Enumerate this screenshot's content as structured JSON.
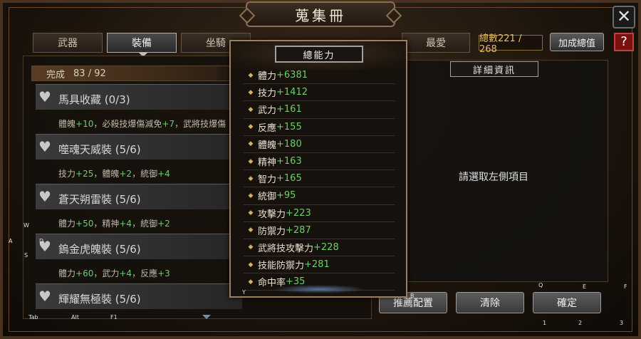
{
  "window": {
    "title": "蒐集冊"
  },
  "tabs": [
    {
      "label": "武器"
    },
    {
      "label": "裝備"
    },
    {
      "label": "坐騎"
    },
    {
      "label": "最愛"
    }
  ],
  "total": {
    "text": "總數221 / 268"
  },
  "bonus_button": "加成總值",
  "help_button": "?",
  "close_button": "✕",
  "progress": {
    "label": "完成",
    "value": "83 / 92",
    "fraction": 0.902
  },
  "sets": [
    {
      "name": "馬具收藏 (0/3)",
      "parts": [
        [
          "體魄",
          "+10"
        ],
        [
          "，必殺技爆傷減免",
          "+7"
        ],
        [
          "，武將技爆傷",
          ""
        ]
      ]
    },
    {
      "name": "噬魂天威裝 (5/6)",
      "parts": [
        [
          "技力",
          "+25"
        ],
        [
          "，體魄",
          "+2"
        ],
        [
          "，統御",
          "+4"
        ]
      ]
    },
    {
      "name": "蒼天朔雷裝 (5/6)",
      "parts": [
        [
          "體力",
          "+50"
        ],
        [
          "，精神",
          "+4"
        ],
        [
          "，統御",
          "+2"
        ]
      ]
    },
    {
      "name": "鎢金虎魄裝 (5/6)",
      "parts": [
        [
          "體力",
          "+60"
        ],
        [
          "，武力",
          "+4"
        ],
        [
          "，反應",
          "+3"
        ]
      ]
    },
    {
      "name": "輝耀無極裝 (5/6)",
      "parts": []
    }
  ],
  "popup": {
    "title": "總能力",
    "stats": [
      {
        "name": "體力",
        "value": "+6381"
      },
      {
        "name": "技力",
        "value": "+1412"
      },
      {
        "name": "武力",
        "value": "+161"
      },
      {
        "name": "反應",
        "value": "+155"
      },
      {
        "name": "體魄",
        "value": "+180"
      },
      {
        "name": "精神",
        "value": "+163"
      },
      {
        "name": "智力",
        "value": "+165"
      },
      {
        "name": "統御",
        "value": "+95"
      },
      {
        "name": "攻擊力",
        "value": "+223"
      },
      {
        "name": "防禦力",
        "value": "+287"
      },
      {
        "name": "武將技攻擊力",
        "value": "+228"
      },
      {
        "name": "技能防禦力",
        "value": "+281"
      },
      {
        "name": "命中率",
        "value": "+35"
      }
    ]
  },
  "detail": {
    "title": "詳細資訊",
    "empty_text": "請選取左側項目"
  },
  "buttons": {
    "recommend": "推薦配置",
    "clear": "清除",
    "confirm": "確定"
  },
  "hotkeys": [
    "W",
    "A",
    "S",
    "D",
    "Tab",
    "Alt",
    "F1",
    "Y",
    "B",
    "Q",
    "E",
    "F",
    "1",
    "2",
    "3"
  ],
  "colors": {
    "stat_bonus": "#6ad06a",
    "total_text": "#e8c060",
    "help_bg": "#7a1010"
  }
}
